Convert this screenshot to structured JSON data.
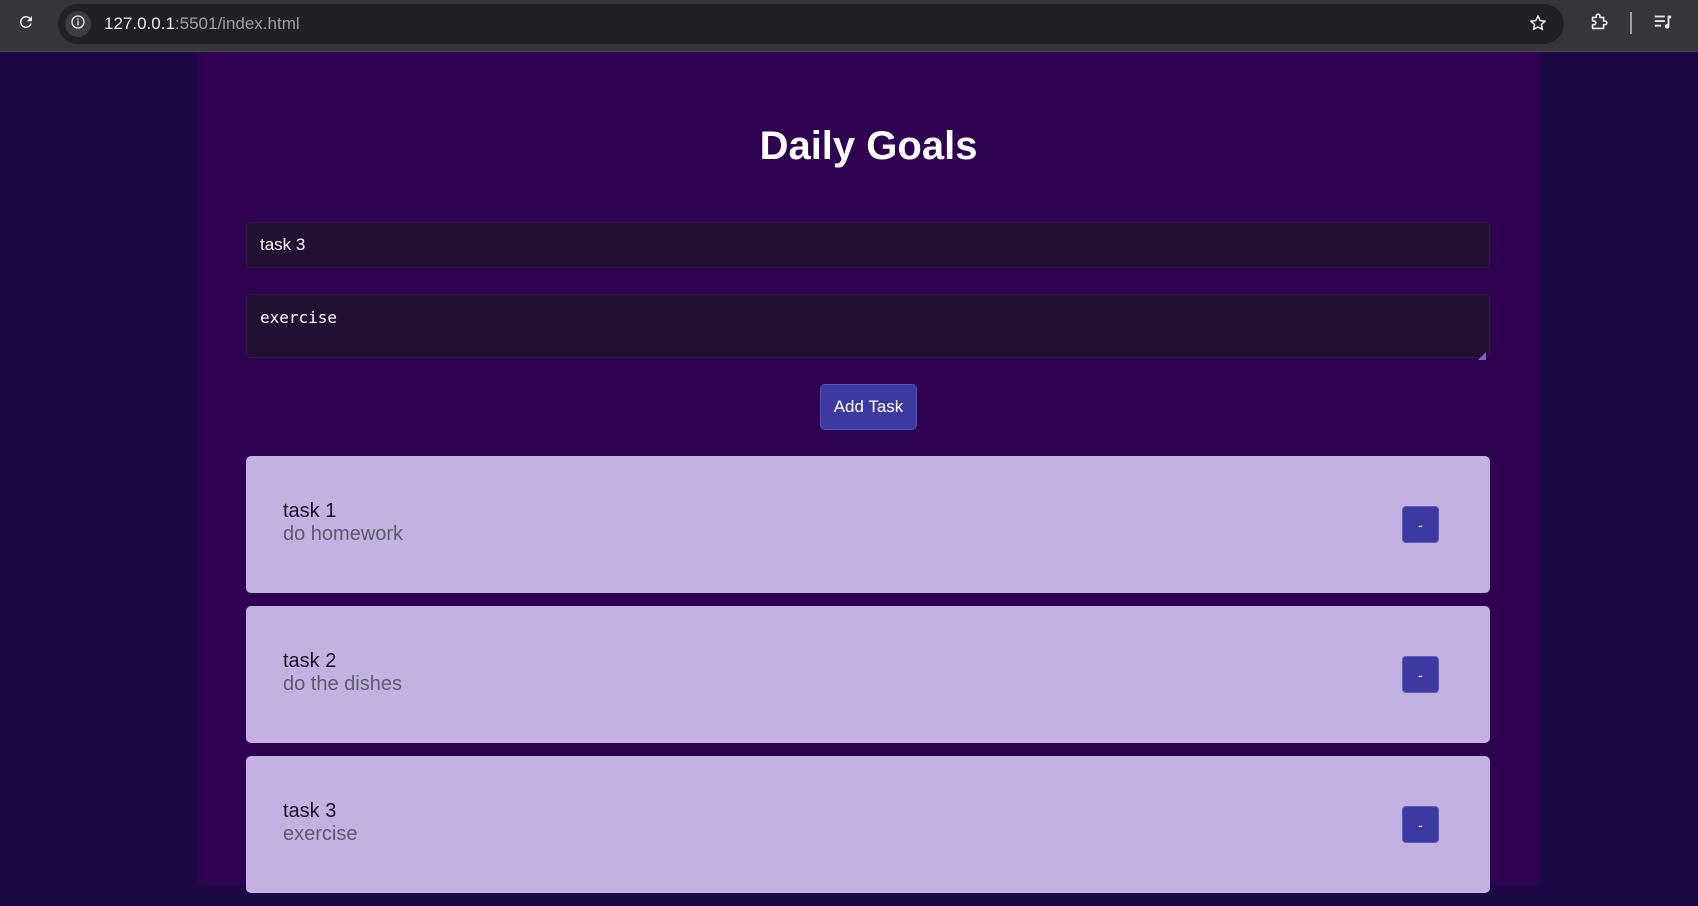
{
  "browser": {
    "url_host": "127.0.0.1",
    "url_rest": ":5501/index.html"
  },
  "app": {
    "title": "Daily Goals",
    "title_input_value": "task 3",
    "description_input_value": "exercise",
    "add_button_label": "Add Task",
    "remove_button_label": "-"
  },
  "tasks": [
    {
      "title": "task 1",
      "description": "do homework"
    },
    {
      "title": "task 2",
      "description": "do the dishes"
    },
    {
      "title": "task 3",
      "description": "exercise"
    }
  ],
  "colors": {
    "page_background": "#1c0843",
    "container_background": "#2f0151",
    "card_background": "#c3b2e1",
    "button_accent": "#3c3aa1",
    "input_background": "#221033"
  },
  "icons": [
    "reload-icon",
    "site-info-icon",
    "bookmark-star-icon",
    "extensions-icon",
    "media-playlist-icon"
  ]
}
